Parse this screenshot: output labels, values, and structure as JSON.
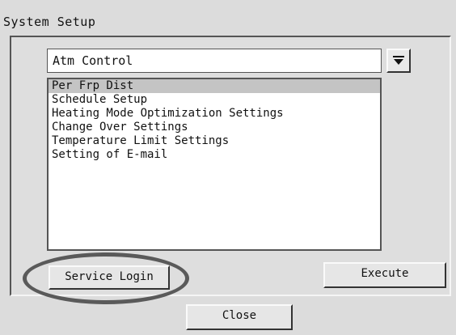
{
  "window": {
    "title": "System Setup"
  },
  "dropdown": {
    "selected": "Atm Control",
    "icon": "chevron-down-icon"
  },
  "list": {
    "items": [
      "Per Frp Dist",
      "Schedule Setup",
      "Heating Mode Optimization Settings",
      "Change Over Settings",
      "Temperature Limit Settings",
      "Setting of E-mail"
    ],
    "selected_index": 0
  },
  "buttons": {
    "service_login": "Service Login",
    "execute": "Execute",
    "close": "Close"
  },
  "colors": {
    "background": "#dcdcdc",
    "highlight_circle": "#5a5a5a",
    "selection": "#c4c4c4"
  }
}
